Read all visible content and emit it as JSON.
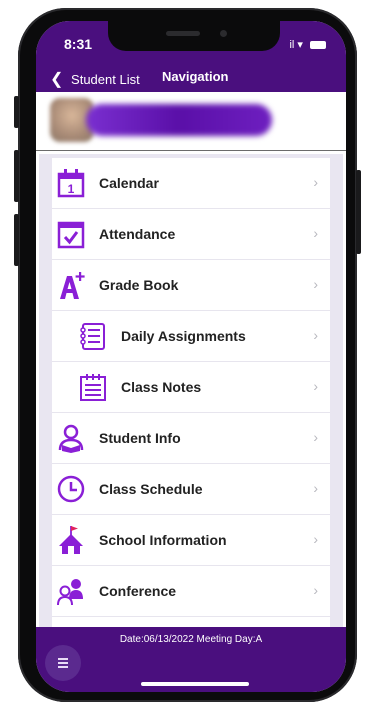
{
  "status_bar": {
    "time": "8:31",
    "signal_text": "il"
  },
  "header": {
    "back_label": "Student List",
    "title": "Navigation"
  },
  "menu": {
    "items": [
      {
        "label": "Calendar",
        "icon": "calendar-icon"
      },
      {
        "label": "Attendance",
        "icon": "attendance-check-icon"
      },
      {
        "label": "Grade Book",
        "icon": "grade-a-plus-icon"
      },
      {
        "label": "Daily Assignments",
        "icon": "assignments-list-icon"
      },
      {
        "label": "Class Notes",
        "icon": "notes-icon"
      },
      {
        "label": "Student Info",
        "icon": "student-reading-icon"
      },
      {
        "label": "Class Schedule",
        "icon": "clock-icon"
      },
      {
        "label": "School Information",
        "icon": "school-house-icon"
      },
      {
        "label": "Conference",
        "icon": "conference-icon"
      }
    ],
    "calendar_day": "1",
    "partial_icon_text": "A+"
  },
  "footer": {
    "date_text": "Date:06/13/2022 Meeting Day:A"
  },
  "colors": {
    "brand": "#4a0f7e",
    "icon": "#8a1fd6"
  }
}
